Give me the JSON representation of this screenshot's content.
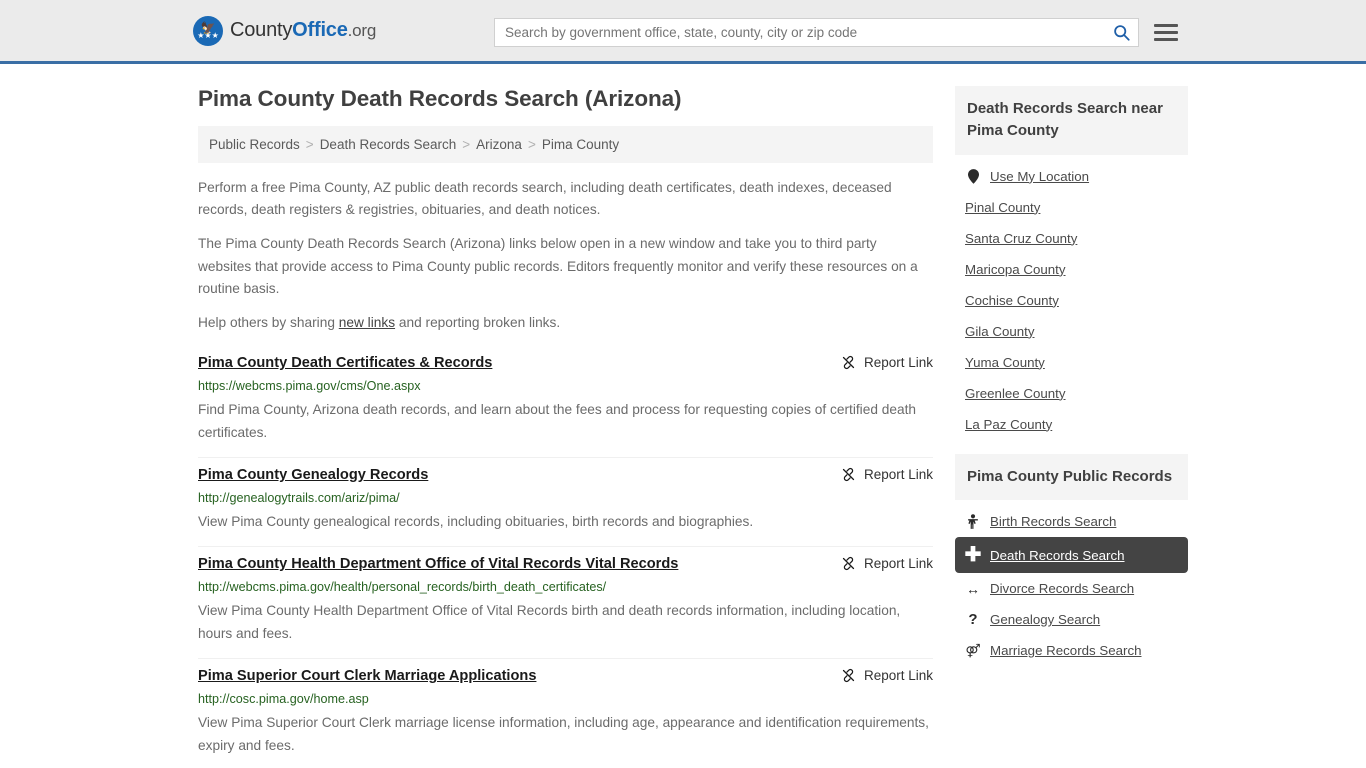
{
  "header": {
    "logo": {
      "text_county": "County",
      "text_office": "Office",
      "text_org": ".org",
      "mark_icon": "eagle-stars-emblem"
    },
    "search": {
      "placeholder": "Search by government office, state, county, city or zip code",
      "value": "",
      "search_icon": "search-icon",
      "menu_icon": "hamburger-menu-icon"
    }
  },
  "page": {
    "title": "Pima County Death Records Search (Arizona)"
  },
  "breadcrumb": {
    "items": [
      {
        "label": "Public Records"
      },
      {
        "label": "Death Records Search"
      },
      {
        "label": "Arizona"
      },
      {
        "label": "Pima County"
      }
    ],
    "separator": ">"
  },
  "intro": {
    "p1": "Perform a free Pima County, AZ public death records search, including death certificates, death indexes, deceased records, death registers & registries, obituaries, and death notices.",
    "p2": "The Pima County Death Records Search (Arizona) links below open in a new window and take you to third party websites that provide access to Pima County public records. Editors frequently monitor and verify these resources on a routine basis.",
    "p3_before": "Help others by sharing ",
    "p3_link": "new links",
    "p3_after": " and reporting broken links."
  },
  "results": {
    "report_label": "Report Link",
    "report_icon": "broken-link-icon",
    "items": [
      {
        "title": "Pima County Death Certificates & Records",
        "url": "https://webcms.pima.gov/cms/One.aspx",
        "description": "Find Pima County, Arizona death records, and learn about the fees and process for requesting copies of certified death certificates."
      },
      {
        "title": "Pima County Genealogy Records",
        "url": "http://genealogytrails.com/ariz/pima/",
        "description": "View Pima County genealogical records, including obituaries, birth records and biographies."
      },
      {
        "title": "Pima County Health Department Office of Vital Records Vital Records",
        "url": "http://webcms.pima.gov/health/personal_records/birth_death_certificates/",
        "description": "View Pima County Health Department Office of Vital Records birth and death records information, including location, hours and fees."
      },
      {
        "title": "Pima Superior Court Clerk Marriage Applications",
        "url": "http://cosc.pima.gov/home.asp",
        "description": "View Pima Superior Court Clerk marriage license information, including age, appearance and identification requirements, expiry and fees."
      }
    ]
  },
  "sidebar": {
    "nearby": {
      "title": "Death Records Search near Pima County",
      "items": [
        {
          "label": "Use My Location",
          "icon": "map-pin-icon"
        },
        {
          "label": "Pinal County",
          "icon": ""
        },
        {
          "label": "Santa Cruz County",
          "icon": ""
        },
        {
          "label": "Maricopa County",
          "icon": ""
        },
        {
          "label": "Cochise County",
          "icon": ""
        },
        {
          "label": "Gila County",
          "icon": ""
        },
        {
          "label": "Yuma County",
          "icon": ""
        },
        {
          "label": "Greenlee County",
          "icon": ""
        },
        {
          "label": "La Paz County",
          "icon": ""
        }
      ]
    },
    "public_records": {
      "title": "Pima County Public Records",
      "items": [
        {
          "label": "Birth Records Search",
          "icon": "baby-icon",
          "active": false
        },
        {
          "label": "Death Records Search",
          "icon": "cross-icon",
          "active": true
        },
        {
          "label": "Divorce Records Search",
          "icon": "left-right-arrow-icon",
          "active": false
        },
        {
          "label": "Genealogy Search",
          "icon": "question-mark-icon",
          "active": false
        },
        {
          "label": "Marriage Records Search",
          "icon": "gender-symbols-icon",
          "active": false
        }
      ]
    }
  },
  "colors": {
    "header_bg": "#ebebeb",
    "header_border": "#3a6ea5",
    "brand_blue": "#1a69b5",
    "url_green": "#276221",
    "active_bg": "#444444",
    "panel_bg": "#f4f4f4"
  }
}
